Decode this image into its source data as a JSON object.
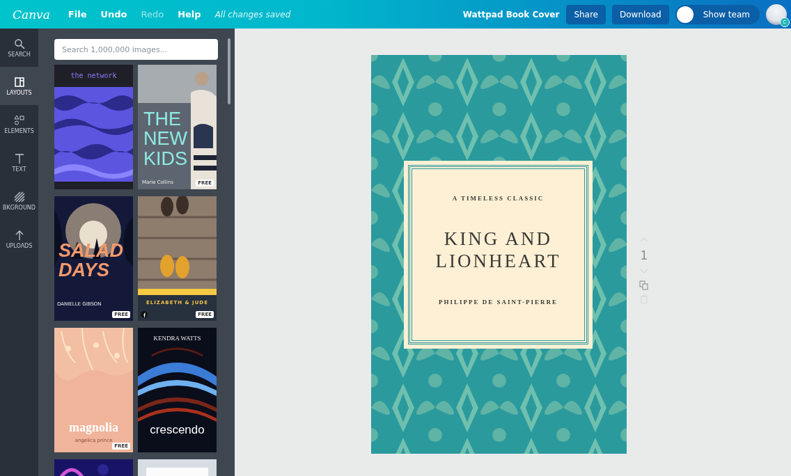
{
  "topbar": {
    "logo": "Canva",
    "menu": [
      {
        "label": "File",
        "disabled": false
      },
      {
        "label": "Undo",
        "disabled": false
      },
      {
        "label": "Redo",
        "disabled": true
      },
      {
        "label": "Help",
        "disabled": false
      }
    ],
    "save_status": "All changes saved",
    "design_title": "Wattpad Book Cover",
    "buttons": [
      "Share",
      "Download"
    ],
    "team_button": "Show team",
    "avatar_badge": "C"
  },
  "tools": [
    {
      "label": "SEARCH",
      "kind": "search",
      "selected": false
    },
    {
      "label": "LAYOUTS",
      "kind": "layouts",
      "selected": true
    },
    {
      "label": "ELEMENTS",
      "kind": "elements",
      "selected": false
    },
    {
      "label": "TEXT",
      "kind": "text",
      "selected": false
    },
    {
      "label": "BKGROUND",
      "kind": "background",
      "selected": false
    },
    {
      "label": "UPLOADS",
      "kind": "uploads",
      "selected": false
    }
  ],
  "panel": {
    "search": {
      "placeholder": "Search 1,000,000 images..."
    },
    "templates": [
      {
        "kind": "network",
        "title": "the network"
      },
      {
        "kind": "newkids",
        "title": "THE NEW KIDS",
        "author": "Marie Collins",
        "badge": "FREE"
      },
      {
        "kind": "salad",
        "title": "SALAD DAYS",
        "author": "DANIELLE GIBSON",
        "badge": "FREE"
      },
      {
        "kind": "elizabeth",
        "title": "ELIZABETH & JUDE",
        "badge": "FREE"
      },
      {
        "kind": "magnolia",
        "title": "magnolia",
        "author": "angelica prince",
        "badge": "FREE"
      },
      {
        "kind": "crescendo",
        "author": "KENDRA WATTS",
        "title": "crescendo"
      },
      {
        "kind": "violet"
      },
      {
        "kind": "pale"
      }
    ]
  },
  "canvas": {
    "cover": {
      "kicker": "A TIMELESS CLASSIC",
      "title_lines": [
        "KING AND",
        "LIONHEART"
      ],
      "author": "PHILIPPE DE SAINT-PIERRE"
    },
    "page_number": "1"
  }
}
